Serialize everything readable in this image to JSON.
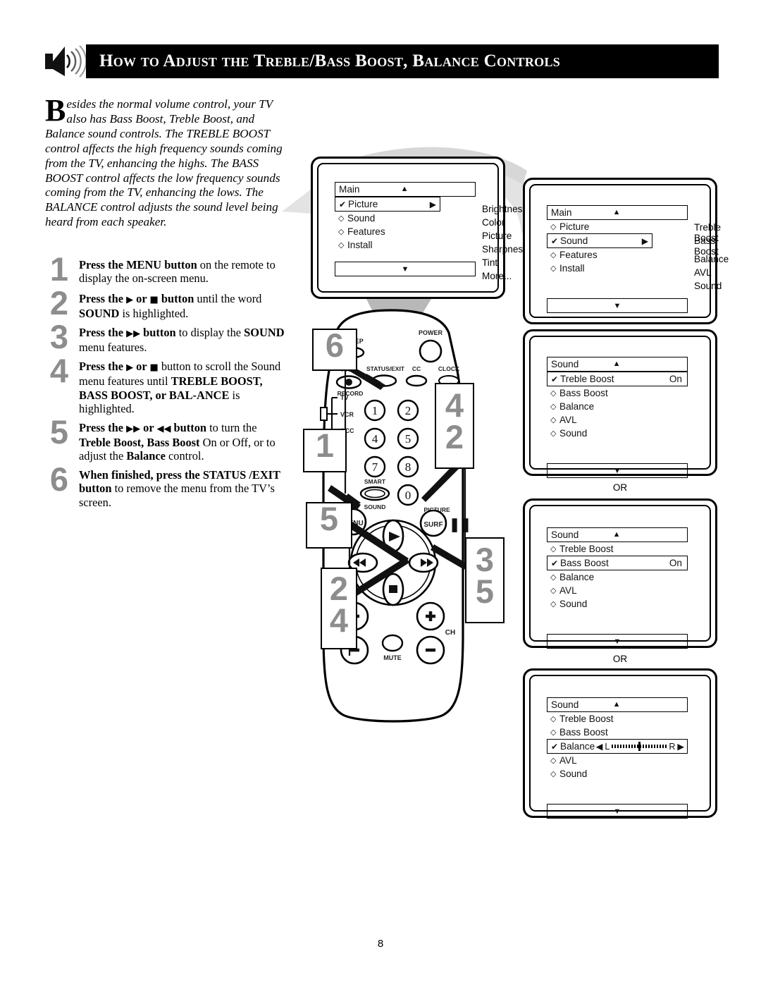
{
  "header": {
    "title": "How to Adjust the Treble/Bass Boost, Balance Controls",
    "icon": "speaker-sound-icon"
  },
  "intro": {
    "dropcap": "B",
    "text": "esides the normal volume control, your TV also has Bass Boost, Treble Boost, and Balance sound controls. The TREBLE BOOST control affects the high frequency sounds coming from the TV, enhancing the highs. The BASS BOOST control affects the low frequency sounds coming from the TV, enhancing the lows. The BALANCE control adjusts the sound level being heard from each speaker."
  },
  "steps": [
    {
      "num": "1",
      "html": "<b>Press the MENU button</b> on the remote to display the on-screen menu."
    },
    {
      "num": "2",
      "html": "<b>Press the <span class='gl'>▶</span> or <span class='gl'>■</span> button</b> until the word <b>SOUND</b> is highlighted."
    },
    {
      "num": "3",
      "html": "<b>Press the <span class='gl'>▶▶</span> button</b> to display the <b>SOUND</b> menu features."
    },
    {
      "num": "4",
      "html": "<b>Press the <span class='gl'>▶</span> or <span class='gl'>■</span></b> button to scroll the Sound menu features until <b>TREBLE BOOST, BASS BOOST, or BAL-ANCE</b> is highlighted."
    },
    {
      "num": "5",
      "html": "<b>Press the <span class='gl'>▶▶</span> or <span class='gl'>◀◀</span> button</b> to turn the <b>Treble Boost, Bass Boost</b> On or Off, or to adjust the <b>Balance</b> control."
    },
    {
      "num": "6",
      "html": "<b>When finished, press the STATUS /EXIT button</b> to remove the menu from the TV’s screen."
    }
  ],
  "screens": [
    {
      "id": "screen-main-picture",
      "title": "Main",
      "up_arrow": "▲",
      "down_arrow": "▼",
      "items": [
        {
          "bullet": "✔",
          "label": "Picture",
          "selected": true,
          "right_arrow": "▶"
        },
        {
          "bullet": "◇",
          "label": "Sound",
          "selected": false
        },
        {
          "bullet": "◇",
          "label": "Features",
          "selected": false
        },
        {
          "bullet": "◇",
          "label": "Install",
          "selected": false
        }
      ],
      "submenu": [
        "Brightness",
        "Color",
        "Picture",
        "Sharpness",
        "Tint",
        "More..."
      ]
    },
    {
      "id": "screen-main-sound",
      "title": "Main",
      "up_arrow": "▲",
      "down_arrow": "▼",
      "items": [
        {
          "bullet": "◇",
          "label": "Picture",
          "selected": false
        },
        {
          "bullet": "✔",
          "label": "Sound",
          "selected": true,
          "right_arrow": "▶"
        },
        {
          "bullet": "◇",
          "label": "Features",
          "selected": false
        },
        {
          "bullet": "◇",
          "label": "Install",
          "selected": false
        }
      ],
      "submenu": [
        "Treble Boost",
        "Bass Boost",
        "Balance",
        "AVL",
        "Sound"
      ]
    },
    {
      "id": "screen-sound-treble",
      "title": "Sound",
      "up_arrow": "▲",
      "down_arrow": "▼",
      "items": [
        {
          "bullet": "✔",
          "label": "Treble Boost",
          "selected": true,
          "value": "On"
        },
        {
          "bullet": "◇",
          "label": "Bass Boost",
          "selected": false
        },
        {
          "bullet": "◇",
          "label": "Balance",
          "selected": false
        },
        {
          "bullet": "◇",
          "label": "AVL",
          "selected": false
        },
        {
          "bullet": "◇",
          "label": "Sound",
          "selected": false
        }
      ],
      "submenu": []
    },
    {
      "id": "screen-sound-bass",
      "title": "Sound",
      "up_arrow": "▲",
      "down_arrow": "▼",
      "items": [
        {
          "bullet": "◇",
          "label": "Treble Boost",
          "selected": false
        },
        {
          "bullet": "✔",
          "label": "Bass Boost",
          "selected": true,
          "value": "On"
        },
        {
          "bullet": "◇",
          "label": "Balance",
          "selected": false
        },
        {
          "bullet": "◇",
          "label": "AVL",
          "selected": false
        },
        {
          "bullet": "◇",
          "label": "Sound",
          "selected": false
        }
      ],
      "submenu": []
    },
    {
      "id": "screen-sound-balance",
      "title": "Sound",
      "up_arrow": "▲",
      "down_arrow": "▼",
      "items": [
        {
          "bullet": "◇",
          "label": "Treble Boost",
          "selected": false
        },
        {
          "bullet": "◇",
          "label": "Bass Boost",
          "selected": false
        },
        {
          "bullet": "✔",
          "label": "Balance",
          "selected": true,
          "balance": {
            "left_label": "L",
            "right_label": "R",
            "left_arrow": "◀",
            "right_arrow": "▶",
            "position_percent": 50
          }
        },
        {
          "bullet": "◇",
          "label": "AVL",
          "selected": false
        },
        {
          "bullet": "◇",
          "label": "Sound",
          "selected": false
        }
      ],
      "submenu": []
    }
  ],
  "or_labels": {
    "first": "OR",
    "second": "OR"
  },
  "callouts": [
    {
      "id": "callout-6",
      "text": "6"
    },
    {
      "id": "callout-1",
      "text": "1"
    },
    {
      "id": "callout-5",
      "text": "5"
    },
    {
      "id": "callout-24",
      "text": "2\n4"
    },
    {
      "id": "callout-42",
      "text": "4\n2"
    },
    {
      "id": "callout-35",
      "text": "3\n5"
    }
  ],
  "remote": {
    "labels": {
      "sleep": "SLEEP",
      "power": "POWER",
      "a_ch": "A/CH",
      "status_exit": "STATUS/EXIT",
      "cc": "CC",
      "clock": "CLOCK",
      "record": "RECORD",
      "tv": "TV",
      "vcr": "VCR",
      "acc": "ACC",
      "smart": "SMART",
      "sound": "SOUND",
      "menu": "MENU",
      "picture": "PICTURE",
      "surf": "SURF",
      "ch": "CH",
      "mute": "MUTE",
      "pause": "‖"
    },
    "keypad": [
      "1",
      "2",
      "4",
      "5",
      "7",
      "8",
      "0"
    ],
    "dpad": {
      "up": "▶",
      "left": "◀◀",
      "right": "▶▶",
      "down": "■"
    }
  },
  "page_number": "8",
  "colors": {
    "callout_gray": "#8d8d8d",
    "header_bg": "#000000",
    "header_text": "#ffffff",
    "shadow_gray": "#d9d9d9"
  }
}
